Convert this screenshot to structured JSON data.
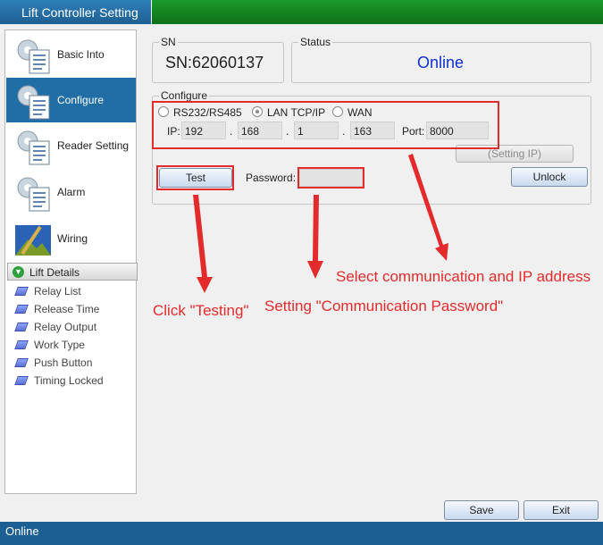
{
  "window": {
    "title": "Lift Controller Setting"
  },
  "sidebar": {
    "items": [
      {
        "label": "Basic Into"
      },
      {
        "label": "Configure"
      },
      {
        "label": "Reader Setting"
      },
      {
        "label": "Alarm"
      },
      {
        "label": "Wiring"
      }
    ],
    "details": {
      "header": "Lift Details",
      "items": [
        "Relay List",
        "Release Time",
        "Relay Output",
        "Work Type",
        "Push Button",
        "Timing Locked"
      ]
    }
  },
  "sn": {
    "title": "SN",
    "value": "SN:62060137"
  },
  "status": {
    "title": "Status",
    "value": "Online",
    "color": "#1030d0"
  },
  "configure": {
    "title": "Configure",
    "options": [
      "RS232/RS485",
      "LAN TCP/IP",
      "WAN"
    ],
    "selected": "LAN TCP/IP",
    "ip_label": "IP:",
    "ip": [
      "192",
      "168",
      "1",
      "163"
    ],
    "dot": ".",
    "port_label": "Port:",
    "port": "8000",
    "setting_ip_button": "(Setting IP)",
    "test_button": "Test",
    "password_label": "Password:",
    "password_value": "",
    "unlock_button": "Unlock"
  },
  "footer": {
    "save_button": "Save",
    "exit_button": "Exit",
    "status_text": "Online"
  },
  "annotations": {
    "select": "Select communication and IP address",
    "password": "Setting \"Communication Password\"",
    "test": "Click \"Testing\"",
    "color": "#e32b2b"
  }
}
